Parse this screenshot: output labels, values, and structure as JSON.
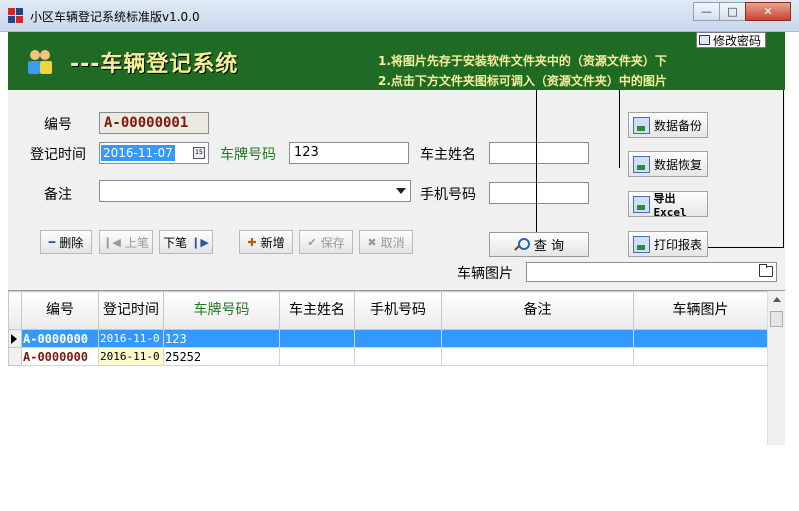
{
  "window": {
    "title": "小区车辆登记系统标准版v1.0.0",
    "minimize_glyph": "—",
    "maximize_glyph": "□",
    "close_glyph": "✕"
  },
  "banner": {
    "title": "---车辆登记系统",
    "tip1": "1.将图片先存于安装软件文件夹中的（资源文件夹）下",
    "tip2": "2.点击下方文件夹图标可调入（资源文件夹）中的图片",
    "change_password": "修改密码"
  },
  "form": {
    "id_label": "编号",
    "id_value": "A-00000001",
    "time_label": "登记时间",
    "time_value": "2016-11-07",
    "plate_label": "车牌号码",
    "plate_value": "123",
    "owner_label": "车主姓名",
    "owner_value": "",
    "note_label": "备注",
    "note_value": "",
    "phone_label": "手机号码",
    "phone_value": "",
    "image_label": "车辆图片",
    "image_value": ""
  },
  "buttons": {
    "delete": "删除",
    "prev": "上笔",
    "next": "下笔",
    "add": "新增",
    "save": "保存",
    "cancel": "取消",
    "query": "查 询",
    "backup": "数据备份",
    "restore": "数据恢复",
    "export": "导出Excel",
    "print": "打印报表"
  },
  "table": {
    "headers": {
      "id": "编号",
      "time": "登记时间",
      "plate": "车牌号码",
      "owner": "车主姓名",
      "phone": "手机号码",
      "note": "备注",
      "image": "车辆图片"
    },
    "rows": [
      {
        "id": "A-0000000",
        "time": "2016-11-0",
        "plate": "123",
        "owner": "",
        "phone": "",
        "note": "",
        "image": "",
        "selected": true
      },
      {
        "id": "A-0000000",
        "time": "2016-11-0",
        "plate": "25252",
        "owner": "",
        "phone": "",
        "note": "",
        "image": "",
        "selected": false
      }
    ]
  },
  "colors": {
    "banner_bg": "#1f6b25",
    "banner_text": "#f5ef9a",
    "selection": "#3399ff",
    "id_text": "#7a1a10",
    "green_label": "#1f7a1f"
  }
}
